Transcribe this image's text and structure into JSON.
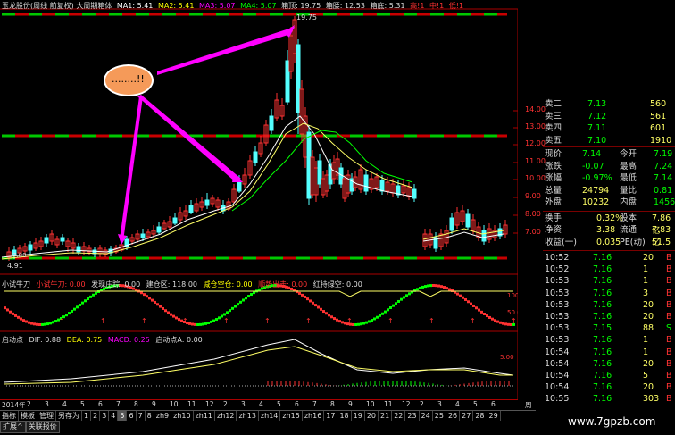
{
  "header": {
    "title": "玉龙股份(周线 前复权) 大周期箱体",
    "ma1": "MA1: 5.41",
    "ma2": "MA2: 5.41",
    "ma3": "MA3: 5.07",
    "ma4": "MA4: 5.07",
    "box_top": "箱顶: 19.75",
    "box_mid": "箱腰: 12.53",
    "box_bottom": "箱底: 5.31",
    "flag1": "高!1",
    "flag2": "中!1",
    "flag3": "低!1",
    "peak_label": "19.75",
    "low_label": "4.91",
    "early_label": "7.00"
  },
  "price_axis": [
    "14.00",
    "13.00",
    "12.00",
    "11.00",
    "10.00",
    "9.00",
    "8.00",
    "7.00"
  ],
  "indicator1": {
    "name": "小试牛刀",
    "v1": "小试牛刀: 0.00",
    "v2": "发现庄踪: 0.00",
    "v3": "建仓区: 118.00",
    "v4": "减仓空仓: 0.00",
    "v5": "顺势出击: 0.00",
    "v6": "红持绿空: 0.00",
    "axis": [
      "100.0",
      "50.00"
    ]
  },
  "indicator2": {
    "name": "启动点",
    "v1": "DIF: 0.88",
    "v2": "DEA: 0.75",
    "v3": "MACD: 0.25",
    "v4": "启动点A: 0.00",
    "axis": [
      "5.00"
    ]
  },
  "date_row": {
    "year": "2014年",
    "labels": [
      "2",
      "3",
      "4",
      "5",
      "6",
      "7",
      "8",
      "9",
      "10",
      "11",
      "12",
      "2",
      "3",
      "4",
      "5",
      "6",
      "7",
      "8",
      "9",
      "10",
      "11",
      "12",
      "2",
      "3",
      "4",
      "5",
      "6"
    ],
    "right": "周线"
  },
  "tabs_row1": [
    "指标",
    "模板",
    "管理",
    "另存为",
    "1",
    "2",
    "3",
    "4",
    "5",
    "6",
    "7",
    "8",
    "zh9",
    "zh10",
    "zh11",
    "zh12",
    "zh13",
    "zh14",
    "zh15",
    "zh16",
    "17",
    "18",
    "19",
    "20",
    "21",
    "22",
    "23",
    "24",
    "25",
    "26",
    "27",
    "28",
    "29"
  ],
  "tabs_row2": [
    "扩展^",
    "关联报价"
  ],
  "quotes": {
    "sell": [
      {
        "label": "卖二",
        "price": "7.13",
        "vol": "560"
      },
      {
        "label": "卖三",
        "price": "7.12",
        "vol": "561"
      },
      {
        "label": "卖四",
        "price": "7.11",
        "vol": "601"
      },
      {
        "label": "卖五",
        "price": "7.10",
        "vol": "1910"
      }
    ],
    "stats": [
      {
        "l1": "现价",
        "v1": "7.14",
        "l2": "今开",
        "v2": "7.19"
      },
      {
        "l1": "涨跌",
        "v1": "-0.07",
        "l2": "最高",
        "v2": "7.24"
      },
      {
        "l1": "涨幅",
        "v1": "-0.97%",
        "l2": "最低",
        "v2": "7.14"
      },
      {
        "l1": "总量",
        "v1": "24794",
        "l2": "量比",
        "v2": "0.81"
      },
      {
        "l1": "外盘",
        "v1": "10232",
        "l2": "内盘",
        "v2": "14562"
      }
    ],
    "stats2": [
      {
        "l1": "换手",
        "v1": "0.32%",
        "l2": "股本",
        "v2": "7.86亿"
      },
      {
        "l1": "净资",
        "v1": "3.38",
        "l2": "流通",
        "v2": "7.83亿"
      },
      {
        "l1": "收益(一)",
        "v1": "0.035",
        "l2": "PE(动)",
        "v2": "51.5"
      }
    ],
    "ticks": [
      {
        "t": "10:52",
        "p": "7.16",
        "v": "20",
        "s": "B"
      },
      {
        "t": "10:52",
        "p": "7.16",
        "v": "1",
        "s": "B"
      },
      {
        "t": "10:53",
        "p": "7.16",
        "v": "1",
        "s": "B"
      },
      {
        "t": "10:53",
        "p": "7.16",
        "v": "3",
        "s": "B"
      },
      {
        "t": "10:53",
        "p": "7.16",
        "v": "20",
        "s": "B"
      },
      {
        "t": "10:53",
        "p": "7.16",
        "v": "20",
        "s": "B"
      },
      {
        "t": "10:53",
        "p": "7.15",
        "v": "88",
        "s": "S"
      },
      {
        "t": "10:53",
        "p": "7.16",
        "v": "1",
        "s": "B"
      },
      {
        "t": "10:54",
        "p": "7.16",
        "v": "1",
        "s": "B"
      },
      {
        "t": "10:54",
        "p": "7.16",
        "v": "20",
        "s": "B"
      },
      {
        "t": "10:54",
        "p": "7.16",
        "v": "5",
        "s": "B"
      },
      {
        "t": "10:54",
        "p": "7.16",
        "v": "20",
        "s": "B"
      },
      {
        "t": "10:55",
        "p": "7.16",
        "v": "303",
        "s": "B"
      }
    ]
  },
  "callout": "........!!",
  "watermark": "www.7gpzb.com",
  "colors": {
    "up": "#ff3232",
    "down": "#54ffff",
    "green": "#00ff00",
    "ma": "#ffff66",
    "accent": "#f59a59"
  }
}
